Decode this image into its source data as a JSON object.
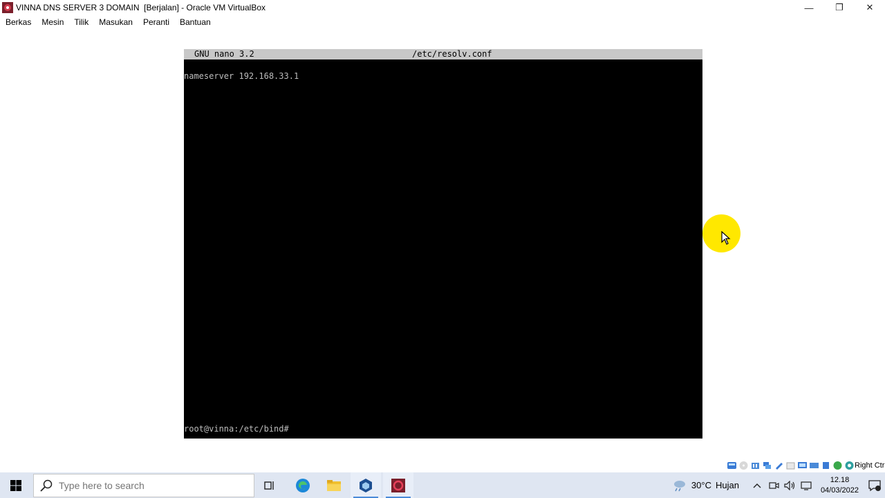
{
  "window": {
    "title": "VINNA DNS SERVER 3 DOMAIN  [Berjalan] - Oracle VM VirtualBox",
    "controls": {
      "minimize": "—",
      "restore": "❐",
      "close": "✕"
    }
  },
  "menubar": {
    "items": [
      "Berkas",
      "Mesin",
      "Tilik",
      "Masukan",
      "Peranti",
      "Bantuan"
    ]
  },
  "vm_screen": {
    "nano_app": "GNU nano 3.2",
    "nano_file": "/etc/resolv.conf",
    "content_line": "nameserver 192.168.33.1",
    "prompt": "root@vinna:/etc/bind#"
  },
  "vm_status": {
    "host_key": "Right Ctrl"
  },
  "taskbar": {
    "search_placeholder": "Type here to search",
    "weather_temp": "30°C",
    "weather_text": "Hujan",
    "time": "12.18",
    "date": "04/03/2022",
    "notification_count": "1"
  },
  "colors": {
    "nano_header_bg": "#c8c8c8",
    "terminal_bg": "#000000",
    "terminal_text": "#bdbdbd",
    "taskbar_bg": "#dfe6f2",
    "cursor_highlight": "#ffe800"
  }
}
